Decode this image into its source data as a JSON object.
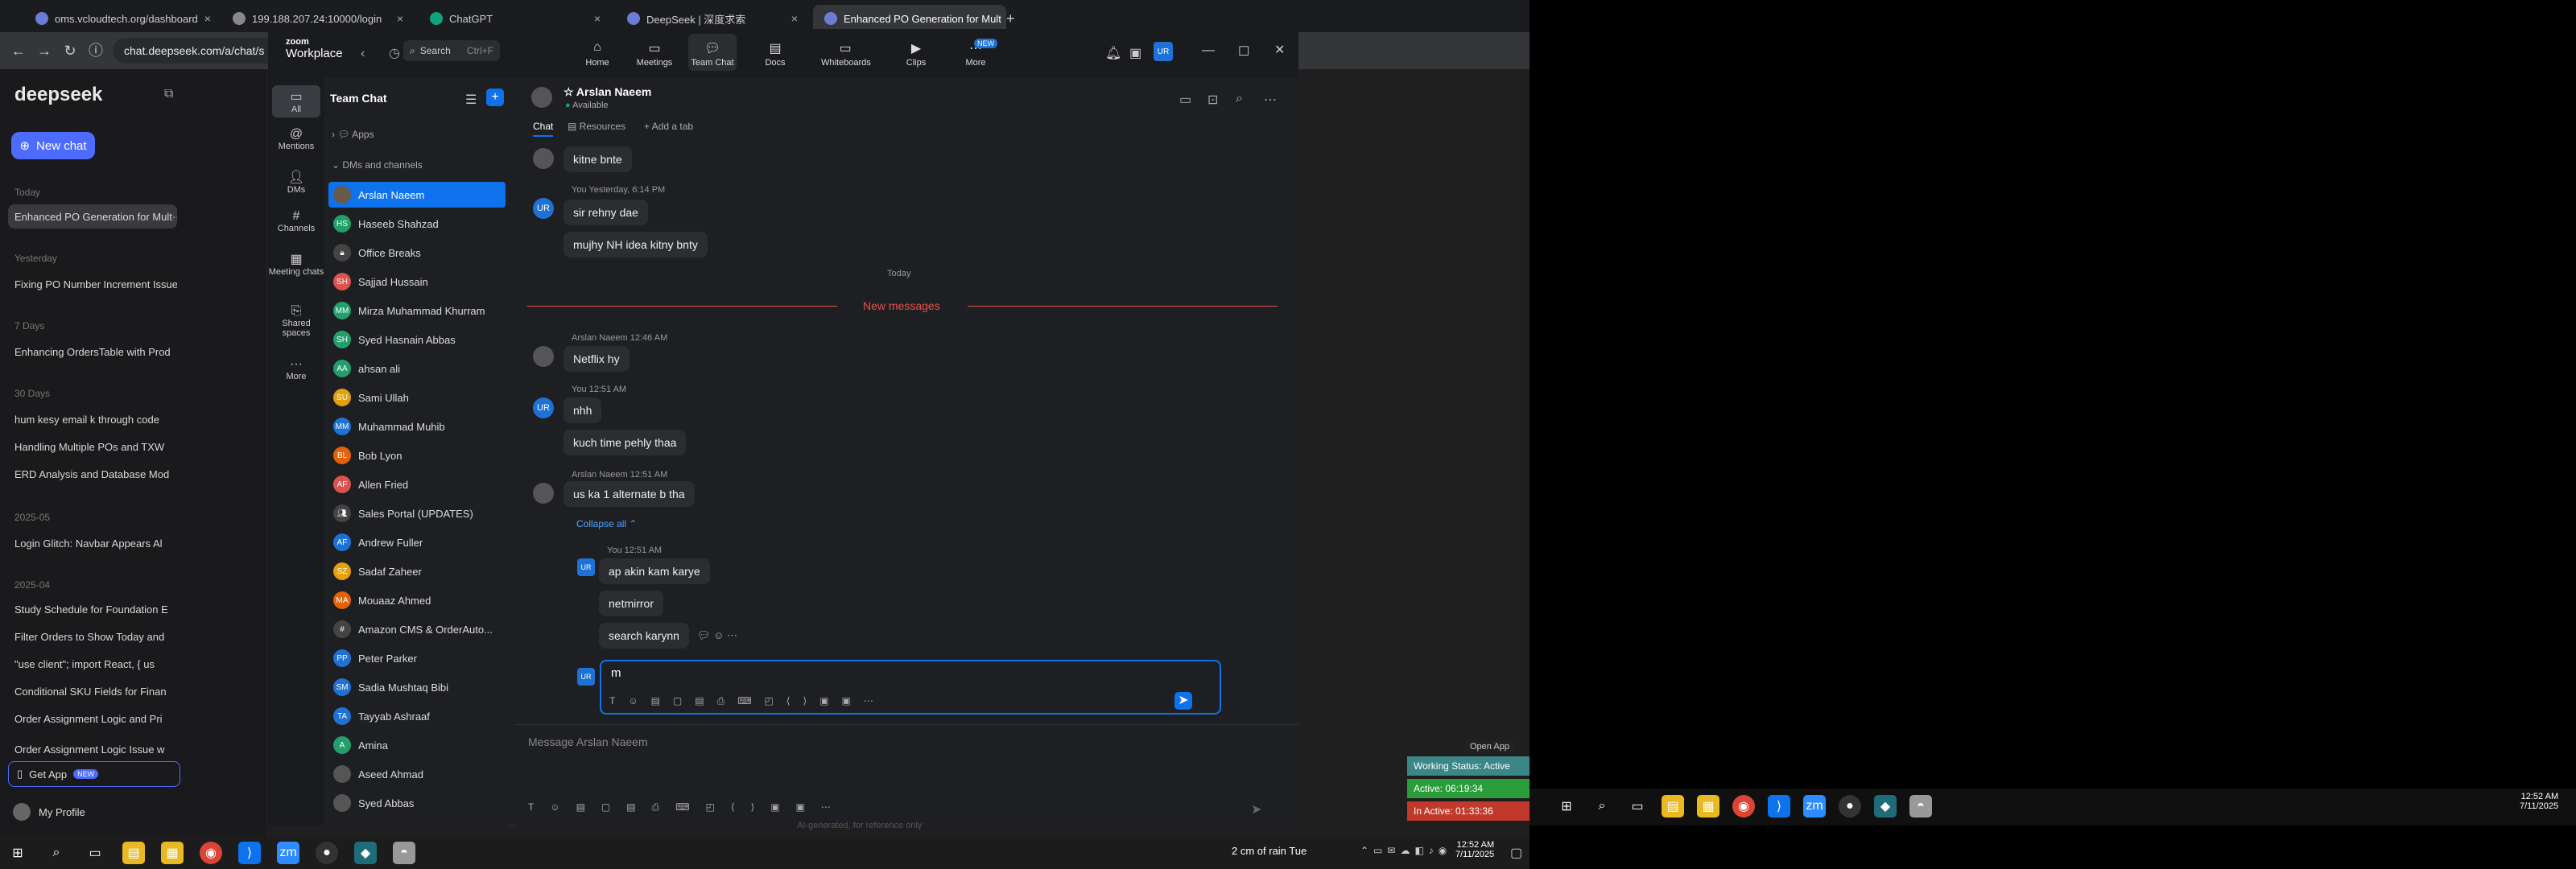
{
  "browser": {
    "tabs": [
      {
        "label": "oms.vcloudtech.org/dashboard"
      },
      {
        "label": "199.188.207.24:10000/login"
      },
      {
        "label": "ChatGPT"
      },
      {
        "label": "DeepSeek | 深度求索"
      },
      {
        "label": "Enhanced PO Generation for Mult",
        "active": true
      }
    ],
    "url": "chat.deepseek.com/a/chat/s"
  },
  "deepseek": {
    "logo": "deepseek",
    "new_chat": "New chat",
    "sections": [
      {
        "title": "Today",
        "items": [
          "Enhanced PO Generation for Mult"
        ]
      },
      {
        "title": "Yesterday",
        "items": [
          "Fixing PO Number Increment Issue"
        ]
      },
      {
        "title": "7 Days",
        "items": [
          "Enhancing OrdersTable with Prod"
        ]
      },
      {
        "title": "30 Days",
        "items": [
          "hum kesy email k through code",
          "Handling Multiple POs and TXW",
          "ERD Analysis and Database Mod"
        ]
      },
      {
        "title": "2025-05",
        "items": [
          "Login Glitch: Navbar Appears Al"
        ]
      },
      {
        "title": "2025-04",
        "items": [
          "Study Schedule for Foundation E",
          "Filter Orders to Show Today and",
          "\"use client\"; import React, { us",
          "Conditional SKU Fields for Finan",
          "Order Assignment Logic and Pri",
          "Order Assignment Logic Issue w"
        ]
      }
    ],
    "get_app": "Get App",
    "get_app_badge": "NEW",
    "my_profile": "My Profile",
    "footer_note": "AI-generated, for reference only"
  },
  "zoom": {
    "brand_top": "zoom",
    "brand_bottom": "Workplace",
    "search_label": "Search",
    "search_shortcut": "Ctrl+F",
    "nav": [
      {
        "label": "Home",
        "icon": "home-icon"
      },
      {
        "label": "Meetings",
        "icon": "video-icon"
      },
      {
        "label": "Team Chat",
        "icon": "chat-icon",
        "active": true
      },
      {
        "label": "Docs",
        "icon": "docs-icon"
      },
      {
        "label": "Whiteboards",
        "icon": "whiteboard-icon"
      },
      {
        "label": "Clips",
        "icon": "clips-icon"
      },
      {
        "label": "More",
        "icon": "more-icon",
        "badge": "NEW"
      }
    ],
    "rail": [
      {
        "label": "All"
      },
      {
        "label": "Mentions"
      },
      {
        "label": "DMs"
      },
      {
        "label": "Channels"
      },
      {
        "label": "Meeting chats"
      },
      {
        "label": "Shared spaces"
      },
      {
        "label": "More"
      }
    ],
    "list_title": "Team Chat",
    "apps_label": "Apps",
    "dms_label": "DMs and channels",
    "contacts": [
      {
        "name": "Arslan Naeem",
        "initials": "",
        "color": "#6a5a4a",
        "selected": true
      },
      {
        "name": "Haseeb Shahzad",
        "initials": "HS",
        "color": "#22a06b"
      },
      {
        "name": "Office Breaks",
        "initials": "",
        "color": "#444"
      },
      {
        "name": "Sajjad Hussain",
        "initials": "SH",
        "color": "#d9534f"
      },
      {
        "name": "Mirza Muhammad Khurram",
        "initials": "MM",
        "color": "#22a06b"
      },
      {
        "name": "Syed Hasnain Abbas",
        "initials": "SH",
        "color": "#22a06b"
      },
      {
        "name": "ahsan ali",
        "initials": "AA",
        "color": "#22a06b"
      },
      {
        "name": "Sami Ullah",
        "initials": "SU",
        "color": "#e5a00d"
      },
      {
        "name": "Muhammad Muhib",
        "initials": "MM",
        "color": "#1e72d6"
      },
      {
        "name": "Bob Lyon",
        "initials": "BL",
        "color": "#e36209"
      },
      {
        "name": "Allen Fried",
        "initials": "AF",
        "color": "#d9534f"
      },
      {
        "name": "Sales Portal (UPDATES)",
        "initials": "",
        "color": "#444"
      },
      {
        "name": "Andrew Fuller",
        "initials": "AF",
        "color": "#1e72d6"
      },
      {
        "name": "Sadaf Zaheer",
        "initials": "SZ",
        "color": "#e5a00d"
      },
      {
        "name": "Mouaaz Ahmed",
        "initials": "MA",
        "color": "#e36209"
      },
      {
        "name": "Amazon CMS & OrderAuto...",
        "initials": "#",
        "color": "#444"
      },
      {
        "name": "Peter Parker",
        "initials": "PP",
        "color": "#1e72d6"
      },
      {
        "name": "Sadia Mushtaq Bibi",
        "initials": "SM",
        "color": "#1e72d6"
      },
      {
        "name": "Tayyab Ashraaf",
        "initials": "TA",
        "color": "#1e72d6"
      },
      {
        "name": "Amina",
        "initials": "A",
        "color": "#22a06b"
      },
      {
        "name": "Aseed Ahmad",
        "initials": "",
        "color": "#555"
      },
      {
        "name": "Syed Abbas",
        "initials": "",
        "color": "#555"
      }
    ],
    "chat": {
      "name": "Arslan Naeem",
      "status": "Available",
      "tabs": [
        "Chat",
        "Resources",
        "+ Add a tab"
      ],
      "today": "Today",
      "new_messages": "New messages",
      "collapse_all": "Collapse all",
      "messages": [
        {
          "from": "them",
          "meta": "",
          "text": "kitne bnte"
        },
        {
          "from": "me",
          "meta": "You Yesterday, 6:14 PM",
          "text": "sir rehny dae"
        },
        {
          "from": "me",
          "meta": "",
          "text": "mujhy NH idea kitny bnty"
        },
        {
          "from": "them",
          "meta": "Arslan Naeem 12:46 AM",
          "text": "Netflix hy"
        },
        {
          "from": "me",
          "meta": "You 12:51 AM",
          "text": "nhh"
        },
        {
          "from": "me",
          "meta": "",
          "text": "kuch time pehly thaa"
        },
        {
          "from": "them",
          "meta": "Arslan Naeem 12:51 AM",
          "text": "us ka 1 alternate b tha"
        },
        {
          "from": "me",
          "meta": "You 12:51 AM",
          "text": "ap akin kam karye"
        },
        {
          "from": "me",
          "meta": "",
          "text": "netmirror"
        },
        {
          "from": "me",
          "meta": "",
          "text": "search karynn"
        }
      ],
      "draft": "m",
      "message_placeholder": "Message Arslan Naeem",
      "me_initials": "UR"
    }
  },
  "desktop": {
    "open_app": "Open App",
    "working_status": "Working Status: Active",
    "active": "Active: 06:19:34",
    "inactive": "In Active: 01:33:36",
    "time": "12:52 AM",
    "date": "7/11/2025",
    "weather": "2 cm of rain Tue",
    "right_time": "12:52 AM",
    "right_date": "7/11/2025"
  },
  "colors": {
    "accent": "#0e72ed",
    "deepseek": "#4d6bfe",
    "new_messages": "#e5534b"
  }
}
